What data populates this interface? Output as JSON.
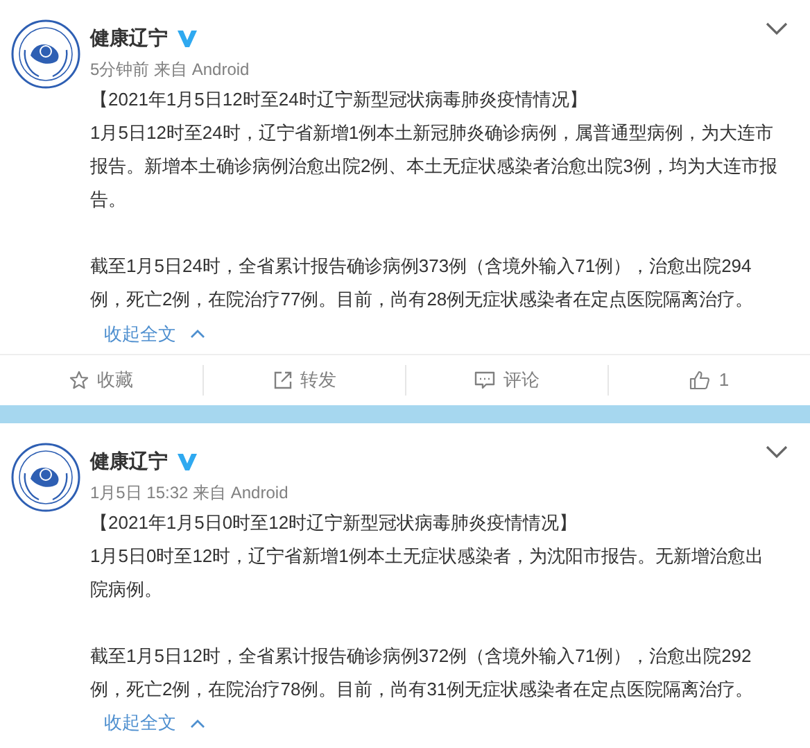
{
  "posts": [
    {
      "author": "健康辽宁",
      "verified": true,
      "meta": "5分钟前 来自 Android",
      "title": "【2021年1月5日12时至24时辽宁新型冠状病毒肺炎疫情情况】",
      "paragraphs": [
        "1月5日12时至24时，辽宁省新增1例本土新冠肺炎确诊病例，属普通型病例，为大连市报告。新增本土确诊病例治愈出院2例、本土无症状感染者治愈出院3例，均为大连市报告。",
        "截至1月5日24时，全省累计报告确诊病例373例（含境外输入71例），治愈出院294例，死亡2例，在院治疗77例。目前，尚有28例无症状感染者在定点医院隔离治疗。"
      ],
      "collapse": "收起全文",
      "actions": [
        {
          "kind": "favorite",
          "label": "收藏"
        },
        {
          "kind": "repost",
          "label": "转发"
        },
        {
          "kind": "comment",
          "label": "评论"
        },
        {
          "kind": "like",
          "label": "1"
        }
      ]
    },
    {
      "author": "健康辽宁",
      "verified": true,
      "meta": "1月5日 15:32 来自 Android",
      "title": "【2021年1月5日0时至12时辽宁新型冠状病毒肺炎疫情情况】",
      "paragraphs": [
        "1月5日0时至12时，辽宁省新增1例本土无症状感染者，为沈阳市报告。无新增治愈出院病例。",
        "截至1月5日12时，全省累计报告确诊病例372例（含境外输入71例），治愈出院292例，死亡2例，在院治疗78例。目前，尚有31例无症状感染者在定点医院隔离治疗。"
      ],
      "collapse": "收起全文"
    }
  ]
}
